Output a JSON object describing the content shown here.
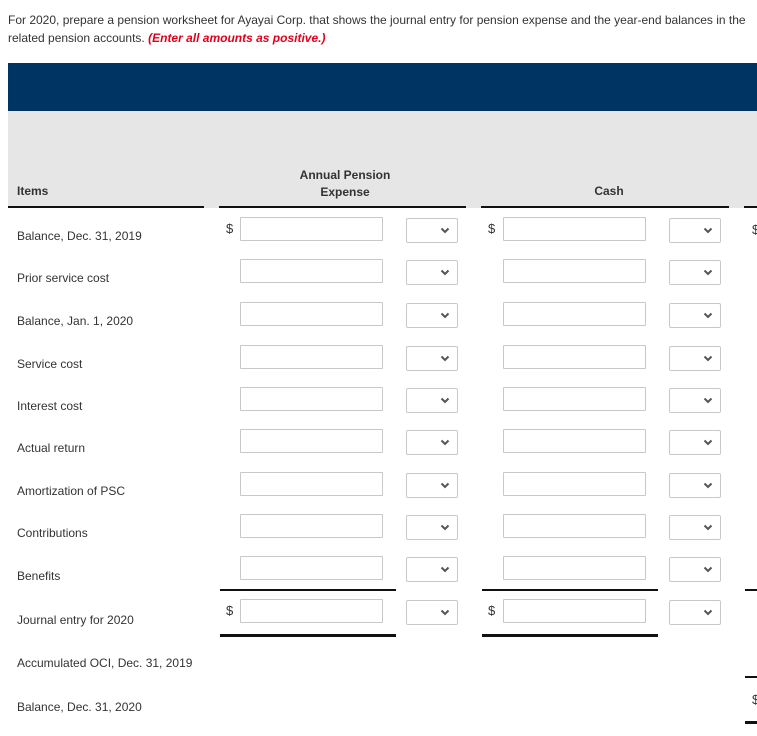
{
  "instructions": {
    "text": "For 2020, prepare a pension worksheet for Ayayai Corp. that shows the journal entry for pension expense and the year-end balances in the related pension accounts.",
    "note": "(Enter all amounts as positive.)"
  },
  "colors": {
    "banner": "#003462",
    "header_band": "#e6e6e6",
    "note": "#e0001b"
  },
  "table": {
    "headers": {
      "items": "Items",
      "annual_pension_expense_line1": "Annual Pension",
      "annual_pension_expense_line2": "Expense",
      "cash": "Cash"
    },
    "currency_symbol": "$",
    "rows": [
      {
        "label": "Balance, Dec. 31, 2019",
        "ape_value": "",
        "ape_dc": "",
        "cash_value": "",
        "cash_dc": ""
      },
      {
        "label": "Prior service cost",
        "ape_value": "",
        "ape_dc": "",
        "cash_value": "",
        "cash_dc": ""
      },
      {
        "label": "Balance, Jan. 1, 2020",
        "ape_value": "",
        "ape_dc": "",
        "cash_value": "",
        "cash_dc": ""
      },
      {
        "label": "Service cost",
        "ape_value": "",
        "ape_dc": "",
        "cash_value": "",
        "cash_dc": ""
      },
      {
        "label": "Interest cost",
        "ape_value": "",
        "ape_dc": "",
        "cash_value": "",
        "cash_dc": ""
      },
      {
        "label": "Actual return",
        "ape_value": "",
        "ape_dc": "",
        "cash_value": "",
        "cash_dc": ""
      },
      {
        "label": "Amortization of PSC",
        "ape_value": "",
        "ape_dc": "",
        "cash_value": "",
        "cash_dc": ""
      },
      {
        "label": "Contributions",
        "ape_value": "",
        "ape_dc": "",
        "cash_value": "",
        "cash_dc": ""
      },
      {
        "label": "Benefits",
        "ape_value": "",
        "ape_dc": "",
        "cash_value": "",
        "cash_dc": ""
      },
      {
        "label": "Journal entry for 2020",
        "ape_value": "",
        "ape_dc": "",
        "cash_value": "",
        "cash_dc": ""
      },
      {
        "label": "Accumulated OCI, Dec. 31, 2019"
      },
      {
        "label": "Balance, Dec. 31, 2020"
      }
    ]
  }
}
